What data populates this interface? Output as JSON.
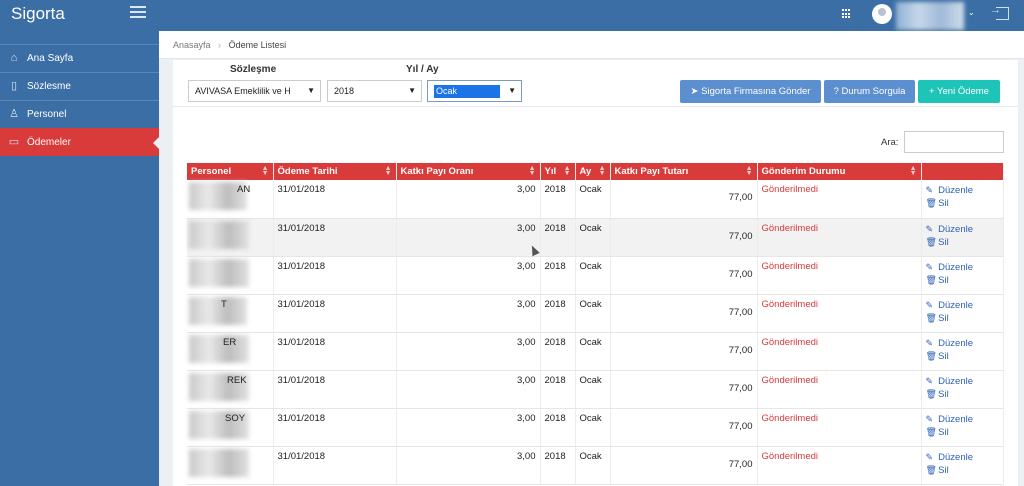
{
  "header": {
    "brand": "Sigorta"
  },
  "sidebar": {
    "items": [
      {
        "label": "Ana Sayfa",
        "icon": "home-icon"
      },
      {
        "label": "Sözlesme",
        "icon": "document-icon"
      },
      {
        "label": "Personel",
        "icon": "user-icon"
      },
      {
        "label": "Ödemeler",
        "icon": "folder-icon",
        "active": true
      }
    ]
  },
  "breadcrumb": {
    "home": "Anasayfa",
    "separator": "›",
    "current": "Ödeme Listesi"
  },
  "filters": {
    "contract_label": "Sözleşme",
    "period_label": "Yıl / Ay",
    "contract_value": "AVIVASA Emeklilik ve H",
    "year_value": "2018",
    "month_value": "Ocak"
  },
  "actions": {
    "send_label": "Sigorta Firmasına Gönder",
    "query_label": "? Durum Sorgula",
    "new_label": "+ Yeni Ödeme"
  },
  "search": {
    "label": "Ara:"
  },
  "table": {
    "headers": [
      "Personel",
      "Ödeme Tarihi",
      "Katkı Payı Oranı",
      "Yıl",
      "Ay",
      "Katkı Payı Tutarı",
      "Gönderim Durumu",
      ""
    ],
    "edit_label": "Düzenle",
    "delete_label": "Sil",
    "rows": [
      {
        "person": "AN",
        "date": "31/01/2018",
        "rate": "3,00",
        "year": "2018",
        "month": "Ocak",
        "amount": "77,00",
        "status": "Gönderilmedi"
      },
      {
        "person": "",
        "date": "31/01/2018",
        "rate": "3,00",
        "year": "2018",
        "month": "Ocak",
        "amount": "77,00",
        "status": "Gönderilmedi"
      },
      {
        "person": "",
        "date": "31/01/2018",
        "rate": "3,00",
        "year": "2018",
        "month": "Ocak",
        "amount": "77,00",
        "status": "Gönderilmedi"
      },
      {
        "person": "T",
        "date": "31/01/2018",
        "rate": "3,00",
        "year": "2018",
        "month": "Ocak",
        "amount": "77,00",
        "status": "Gönderilmedi"
      },
      {
        "person": "ER",
        "date": "31/01/2018",
        "rate": "3,00",
        "year": "2018",
        "month": "Ocak",
        "amount": "77,00",
        "status": "Gönderilmedi"
      },
      {
        "person": "REK",
        "date": "31/01/2018",
        "rate": "3,00",
        "year": "2018",
        "month": "Ocak",
        "amount": "77,00",
        "status": "Gönderilmedi"
      },
      {
        "person": "SOY",
        "date": "31/01/2018",
        "rate": "3,00",
        "year": "2018",
        "month": "Ocak",
        "amount": "77,00",
        "status": "Gönderilmedi"
      },
      {
        "person": "",
        "date": "31/01/2018",
        "rate": "3,00",
        "year": "2018",
        "month": "Ocak",
        "amount": "77,00",
        "status": "Gönderilmedi"
      }
    ]
  }
}
